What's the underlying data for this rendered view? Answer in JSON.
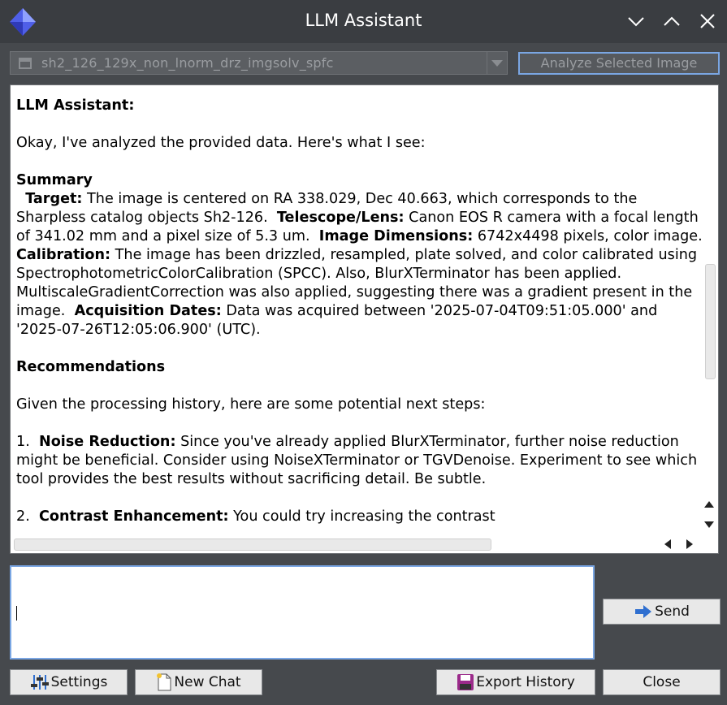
{
  "window": {
    "title": "LLM Assistant"
  },
  "image_select": {
    "value": "sh2_126_129x_non_lnorm_drz_imgsolv_spfc"
  },
  "analyze_button": {
    "label": "Analyze Selected Image"
  },
  "output": {
    "heading": "LLM Assistant:",
    "intro": "Okay, I've analyzed the provided data. Here's what I see:",
    "summary_heading": "Summary",
    "target_label": "Target:",
    "target_text": " The image is centered on RA 338.029, Dec 40.663, which corresponds to the Sharpless catalog objects Sh2-126.  ",
    "telescope_label": "Telescope/Lens:",
    "telescope_text": " Canon EOS R camera with a focal length of 341.02 mm and a pixel size of 5.3 um.  ",
    "dimensions_label": "Image Dimensions:",
    "dimensions_text": " 6742x4498 pixels, color image.  ",
    "calibration_label": "Calibration:",
    "calibration_text": " The image has been drizzled, resampled, plate solved, and color calibrated using SpectrophotometricColorCalibration (SPCC). Also, BlurXTerminator has been applied. MultiscaleGradientCorrection was also applied, suggesting there was a gradient present in the image.  ",
    "acquisition_label": "Acquisition Dates:",
    "acquisition_text": " Data was acquired between '2025-07-04T09:51:05.000' and '2025-07-26T12:05:06.900' (UTC).",
    "recommendations_heading": "Recommendations",
    "recommendations_intro": "Given the processing history, here are some potential next steps:",
    "item1_prefix": "1.  ",
    "item1_label": "Noise Reduction:",
    "item1_text": " Since you've already applied BlurXTerminator, further noise reduction might be beneficial. Consider using NoiseXTerminator or TGVDenoise. Experiment to see which tool provides the best results without sacrificing detail. Be subtle.",
    "item2_prefix": "2.  ",
    "item2_label": "Contrast Enhancement:",
    "item2_text": " You could try increasing the contrast"
  },
  "chat_input": {
    "value": ""
  },
  "buttons": {
    "send": "Send",
    "settings": "Settings",
    "new_chat": "New Chat",
    "export_history": "Export History",
    "close": "Close"
  },
  "colors": {
    "accent": "#7aa6e3",
    "titlebar": "#3a3d41",
    "window_bg": "#46494d"
  }
}
